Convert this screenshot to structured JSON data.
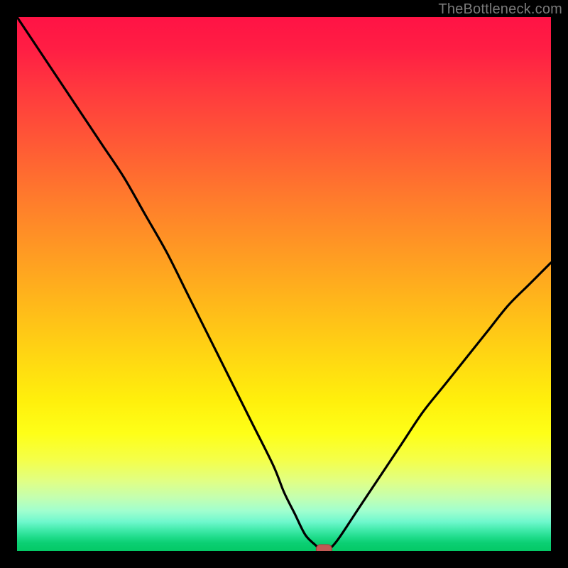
{
  "watermark": "TheBottleneck.com",
  "colors": {
    "frame": "#000000",
    "curve": "#000000",
    "marker_fill": "#c25a54",
    "marker_stroke": "#9e3e3a"
  },
  "chart_data": {
    "type": "line",
    "title": "",
    "xlabel": "",
    "ylabel": "",
    "xlim": [
      0,
      100
    ],
    "ylim": [
      0,
      100
    ],
    "grid": false,
    "legend": false,
    "series": [
      {
        "name": "bottleneck-curve",
        "x": [
          0,
          4,
          8,
          12,
          16,
          20,
          24,
          28,
          32,
          36,
          40,
          44,
          48,
          50,
          52,
          54,
          56,
          57,
          58,
          60,
          64,
          68,
          72,
          76,
          80,
          84,
          88,
          92,
          96,
          100
        ],
        "values": [
          100,
          94,
          88,
          82,
          76,
          70,
          63,
          56,
          48,
          40,
          32,
          24,
          16,
          11,
          7,
          3,
          1,
          0,
          0,
          2,
          8,
          14,
          20,
          26,
          31,
          36,
          41,
          46,
          50,
          54
        ]
      }
    ],
    "marker": {
      "x": 57.5,
      "y": 0,
      "shape": "rounded-rect"
    }
  }
}
